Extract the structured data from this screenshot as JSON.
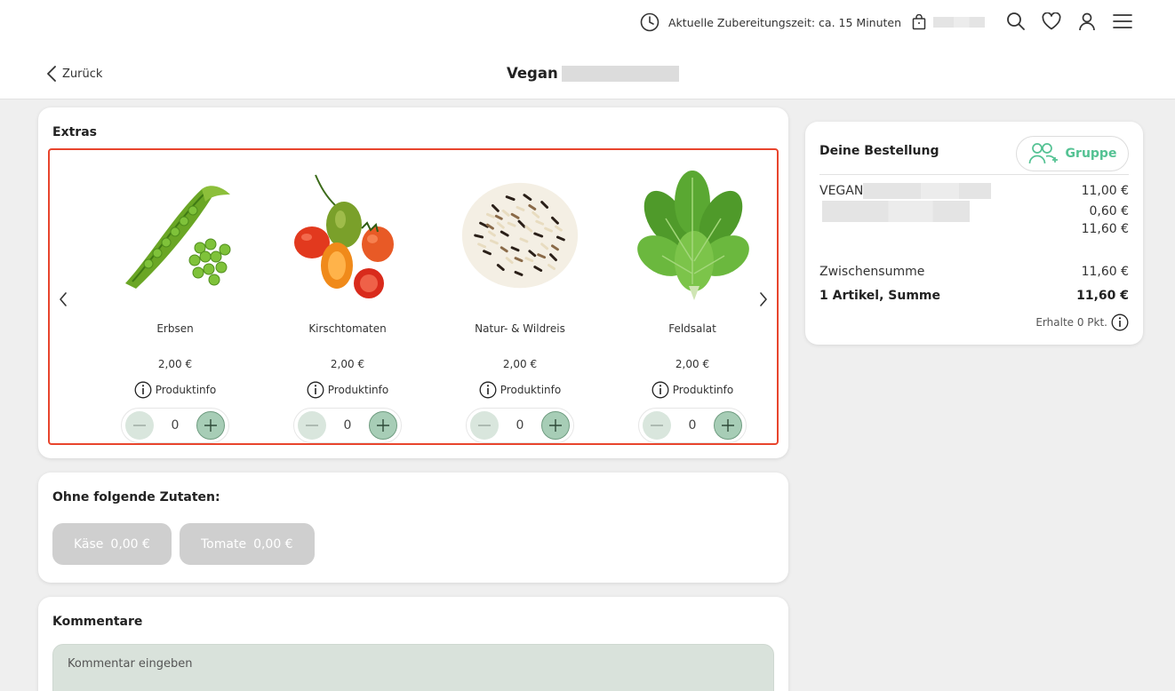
{
  "header": {
    "prep_time_label": "Aktuelle Zubereitungszeit: ca. 15 Minuten",
    "back_label": "Zurück",
    "title": "Vegan"
  },
  "extras": {
    "heading": "Extras",
    "info_label": "Produktinfo",
    "items": [
      {
        "name": "Erbsen",
        "price": "2,00 €",
        "qty": "0"
      },
      {
        "name": "Kirschtomaten",
        "price": "2,00 €",
        "qty": "0"
      },
      {
        "name": "Natur- & Wildreis",
        "price": "2,00 €",
        "qty": "0"
      },
      {
        "name": "Feldsalat",
        "price": "2,00 €",
        "qty": "0"
      }
    ]
  },
  "ohne": {
    "heading": "Ohne folgende Zutaten:",
    "chips": [
      {
        "name": "Käse",
        "price": "0,00 €"
      },
      {
        "name": "Tomate",
        "price": "0,00 €"
      }
    ]
  },
  "kommentare": {
    "heading": "Kommentare",
    "placeholder": "Kommentar eingeben"
  },
  "order": {
    "heading": "Deine Bestellung",
    "group_label": "Gruppe",
    "item_name": "VEGAN",
    "item_price": "11,00 €",
    "extra_price": "0,60 €",
    "item_total": "11,60 €",
    "subtotal_label": "Zwischensumme",
    "subtotal_value": "11,60 €",
    "sum_label": "1 Artikel, Summe",
    "sum_value": "11,60 €",
    "points_label": "Erhalte 0 Pkt."
  },
  "colors": {
    "accent_green": "#54c293",
    "highlight_border": "#e8452d",
    "chip_gray": "#cfcfcf"
  }
}
